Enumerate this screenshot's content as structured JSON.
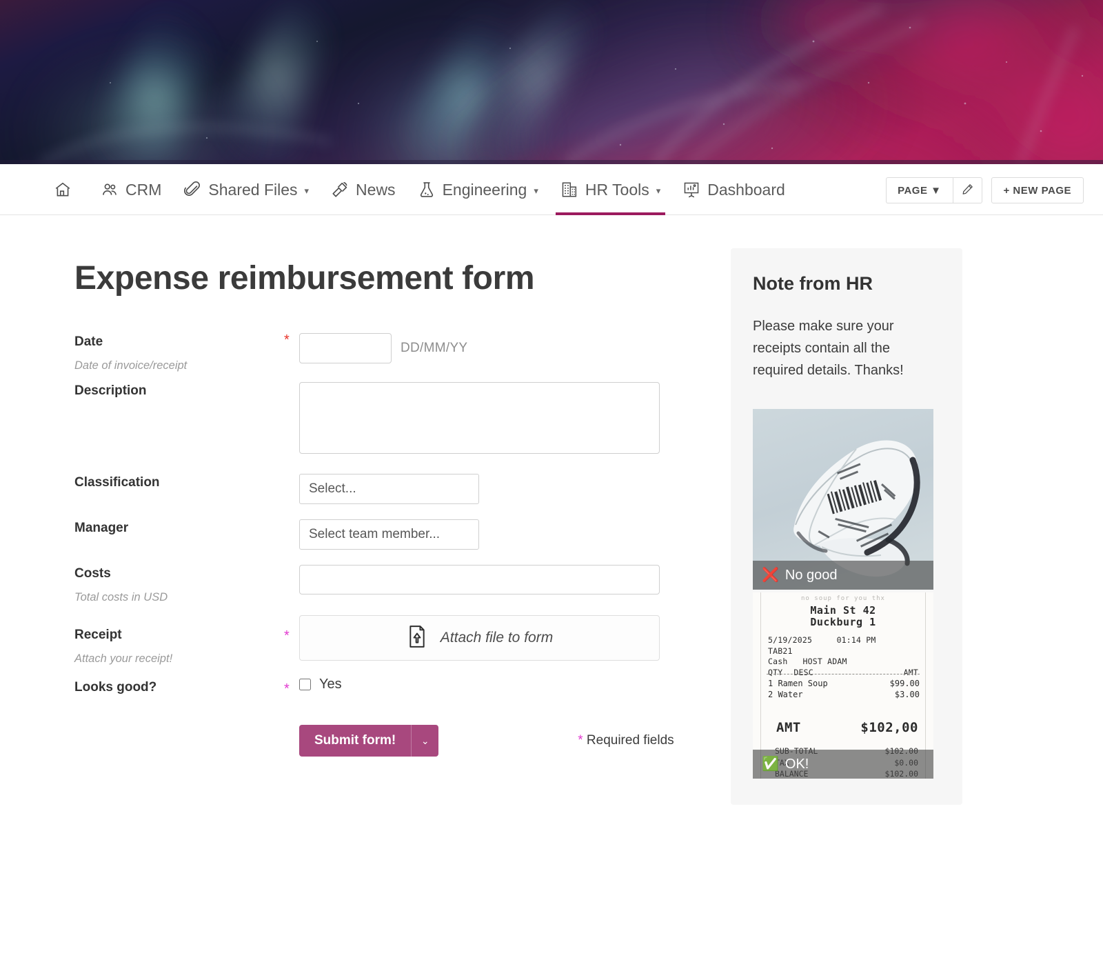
{
  "hero": {
    "alt": "aurora-banner"
  },
  "nav": {
    "items": [
      {
        "icon": "home-icon",
        "label": "",
        "caret": false,
        "active": false,
        "key": "home"
      },
      {
        "icon": "people-icon",
        "label": "CRM",
        "caret": false,
        "active": false,
        "key": "crm"
      },
      {
        "icon": "paperclip-icon",
        "label": "Shared Files",
        "caret": true,
        "active": false,
        "key": "shared-files"
      },
      {
        "icon": "megaphone-icon",
        "label": "News",
        "caret": false,
        "active": false,
        "key": "news"
      },
      {
        "icon": "flask-icon",
        "label": "Engineering",
        "caret": true,
        "active": false,
        "key": "engineering"
      },
      {
        "icon": "building-icon",
        "label": "HR Tools",
        "caret": true,
        "active": true,
        "key": "hr-tools"
      },
      {
        "icon": "presentation-chart-icon",
        "label": "Dashboard",
        "caret": false,
        "active": false,
        "key": "dashboard"
      }
    ],
    "page_button": "PAGE ▼",
    "edit_button_icon": "pencil-icon",
    "new_page_button": "+ NEW PAGE",
    "active_underline_color": "#9c1a5e"
  },
  "form": {
    "title": "Expense reimbursement form",
    "fields": {
      "date": {
        "label": "Date",
        "hint": "Date of invoice/receipt",
        "required_mark": "*",
        "required_color": "#e8332a",
        "value": "",
        "format_hint": "DD/MM/YY"
      },
      "description": {
        "label": "Description",
        "value": ""
      },
      "classification": {
        "label": "Classification",
        "placeholder": "Select..."
      },
      "manager": {
        "label": "Manager",
        "placeholder": "Select team member..."
      },
      "costs": {
        "label": "Costs",
        "hint": "Total costs in USD",
        "value": ""
      },
      "receipt": {
        "label": "Receipt",
        "hint": "Attach your receipt!",
        "required_mark": "*",
        "required_color": "#e23ad0",
        "attach_label": "Attach file to form",
        "attach_icon": "file-upload-icon"
      },
      "looks_good": {
        "label": "Looks good?",
        "required_mark": "*",
        "required_color": "#e23ad0",
        "checkbox_label": "Yes",
        "checked": false
      }
    },
    "submit_label": "Submit form!",
    "submit_color": "#a8487e",
    "submit_caret": "⌄",
    "required_note_star": "*",
    "required_note": " Required fields"
  },
  "aside": {
    "title": "Note from HR",
    "body": "Please make sure your receipts contain all the required details. Thanks!",
    "thumbnails": [
      {
        "kind": "crumpled-receipt-photo",
        "badge_icon": "❌",
        "badge_label": "No good",
        "icon_name": "red-cross-icon"
      },
      {
        "kind": "clean-receipt-photo",
        "badge_icon": "✅",
        "badge_label": "OK!",
        "icon_name": "green-check-icon"
      }
    ],
    "receipt_contents": {
      "faded_top": "no soup for you thx",
      "address_line1": "Main St 42",
      "address_line2": "Duckburg 1",
      "date": "5/19/2025",
      "time": "01:14 PM",
      "table": "TAB21",
      "payment": "Cash",
      "host": "HOST ADAM",
      "col_qty": "QTY",
      "col_desc": "DESC",
      "col_amt": "AMT",
      "items": [
        {
          "line": "1 Ramen Soup",
          "amount": "$99.00"
        },
        {
          "line": "2 Water",
          "amount": "$3.00"
        }
      ],
      "amount_label": "AMT",
      "amount_value": "$102,00",
      "totals": [
        {
          "label": "SUB-TOTAL",
          "value": "$102.00"
        },
        {
          "label": "TAX",
          "value": "$0.00"
        },
        {
          "label": "BALANCE",
          "value": "$102.00"
        }
      ]
    }
  }
}
